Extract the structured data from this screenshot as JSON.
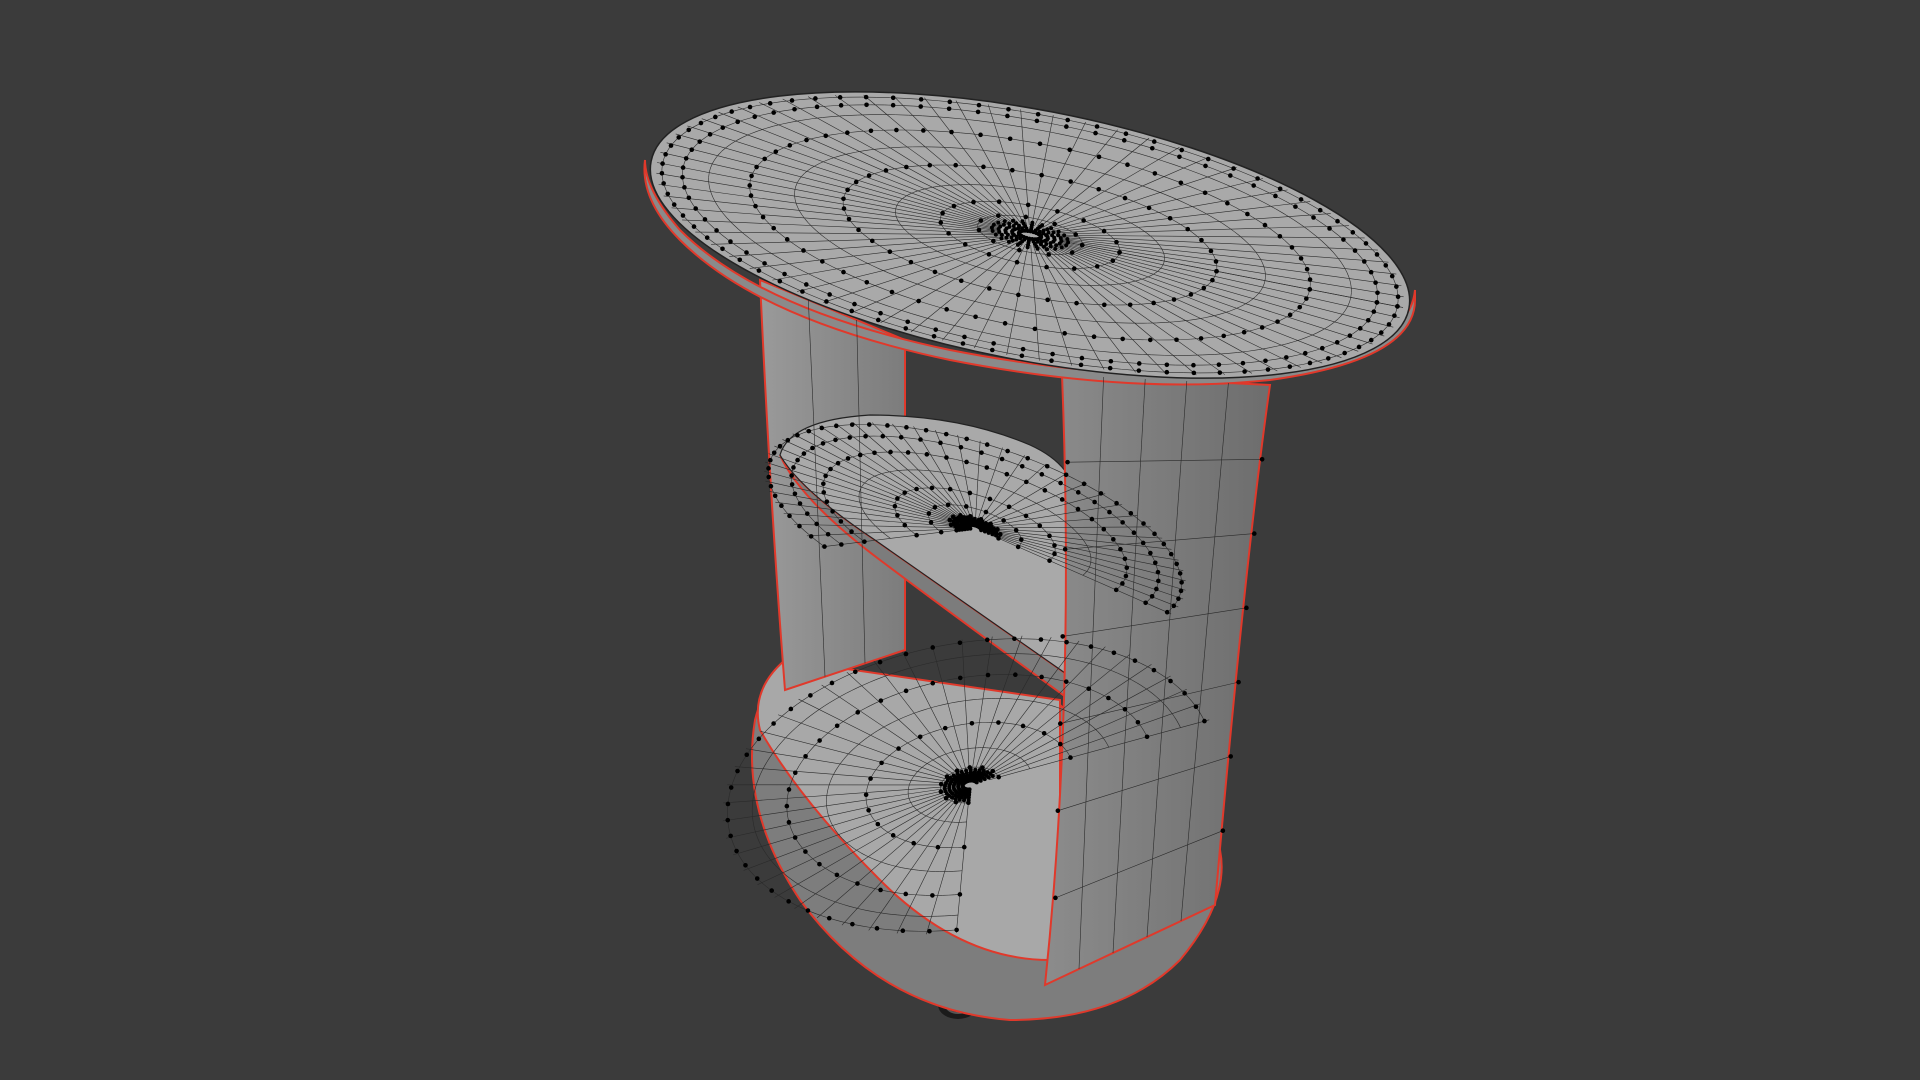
{
  "viewport": {
    "background_color": "#3b3b3b",
    "mesh_face_color": "#a9a9a9",
    "mesh_shadow_color": "#7a7a7a",
    "wire_color": "#2a2a2a",
    "vertex_color": "#000000",
    "seam_color": "#e0392b"
  },
  "model": {
    "object": "side-table-mesh",
    "parts": [
      "table-top",
      "middle-shelf",
      "bottom-base",
      "back-panel-left",
      "front-panel-right",
      "caster-wheel"
    ]
  }
}
